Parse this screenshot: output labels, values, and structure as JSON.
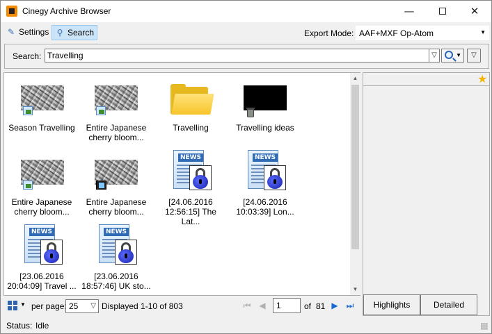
{
  "window": {
    "title": "Cinegy Archive Browser",
    "min_glyph": "—",
    "close_glyph": "✕"
  },
  "toolbar": {
    "settings_label": "Settings",
    "search_label": "Search",
    "export_mode_label": "Export Mode:",
    "export_mode_value": "AAF+MXF Op-Atom"
  },
  "search": {
    "label": "Search:",
    "query": "Travelling"
  },
  "results": {
    "items": [
      {
        "label_lines": [
          "Season Travelling",
          ""
        ],
        "type": "photo"
      },
      {
        "label_lines": [
          "Entire Japanese",
          "cherry bloom..."
        ],
        "type": "photo"
      },
      {
        "label_lines": [
          "Travelling",
          ""
        ],
        "type": "folder"
      },
      {
        "label_lines": [
          "Travelling ideas",
          ""
        ],
        "type": "trash"
      },
      {
        "label_lines": [
          "Entire Japanese",
          "cherry bloom..."
        ],
        "type": "photo"
      },
      {
        "label_lines": [
          "Entire Japanese",
          "cherry bloom..."
        ],
        "type": "video"
      },
      {
        "label_lines": [
          "[24.06.2016",
          "12:56:15] The Lat..."
        ],
        "type": "news"
      },
      {
        "label_lines": [
          "[24.06.2016",
          "10:03:39] Lon..."
        ],
        "type": "news"
      },
      {
        "label_lines": [
          "[23.06.2016",
          "20:04:09] Travel ..."
        ],
        "type": "news"
      },
      {
        "label_lines": [
          "[23.06.2016",
          "18:57:46] UK sto..."
        ],
        "type": "news"
      }
    ],
    "news_band": "NEWS"
  },
  "pager": {
    "per_page_label": "per page:",
    "per_page_value": "25",
    "displayed_text": "Displayed 1-10 of 803",
    "current_page": "1",
    "of_label": "of",
    "total_pages": "81"
  },
  "right_panel": {
    "tabs": [
      "Highlights",
      "Detailed"
    ]
  },
  "status": {
    "label": "Status:",
    "value": "Idle"
  },
  "icons": {
    "app": "cinegy-app-icon",
    "settings": "wrench-icon",
    "search": "magnifier-icon",
    "favorite": "star-icon"
  }
}
